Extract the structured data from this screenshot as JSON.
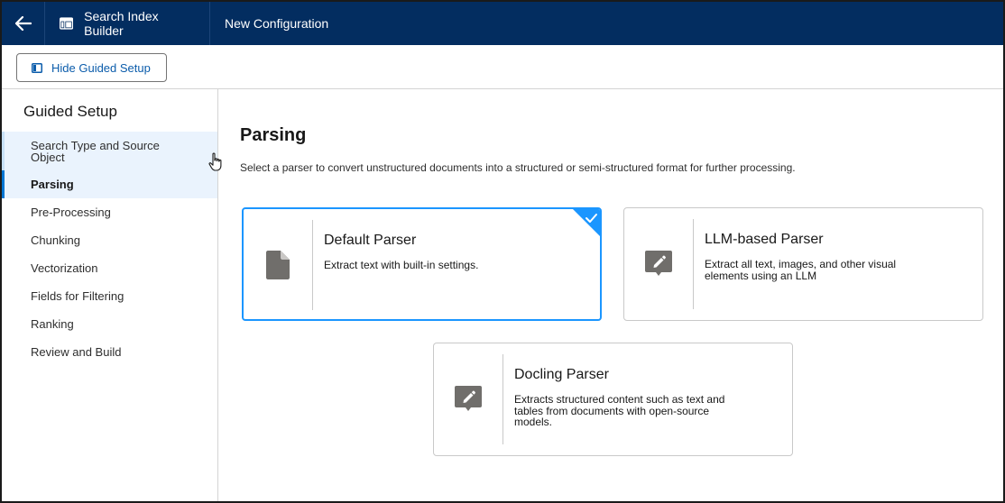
{
  "header": {
    "app_name": "Search Index Builder",
    "page_title": "New Configuration",
    "bg_color": "#032d60"
  },
  "toolbar": {
    "hide_button_label": "Hide Guided Setup"
  },
  "sidebar": {
    "title": "Guided Setup",
    "steps": [
      {
        "label": "Search Type and Source Object",
        "state": "hover"
      },
      {
        "label": "Parsing",
        "state": "active"
      },
      {
        "label": "Pre-Processing",
        "state": "default"
      },
      {
        "label": "Chunking",
        "state": "default"
      },
      {
        "label": "Vectorization",
        "state": "default"
      },
      {
        "label": "Fields for Filtering",
        "state": "default"
      },
      {
        "label": "Ranking",
        "state": "default"
      },
      {
        "label": "Review and Build",
        "state": "default"
      }
    ]
  },
  "main": {
    "title": "Parsing",
    "description": "Select a parser to convert unstructured documents into a structured or semi-structured format for further processing.",
    "options": [
      {
        "title": "Default Parser",
        "description": "Extract text with built-in settings.",
        "icon": "file-icon",
        "selected": true
      },
      {
        "title": "LLM-based Parser",
        "description": "Extract all text, images, and other visual elements using an LLM",
        "icon": "edit-icon",
        "selected": false
      },
      {
        "title": "Docling Parser",
        "description": "Extracts structured content such as text and tables from documents with open-source models.",
        "icon": "edit-icon",
        "selected": false
      }
    ]
  },
  "colors": {
    "accent": "#1b96ff",
    "brand_blue": "#0176d3",
    "link_blue": "#0b5cab",
    "icon_gray": "#706e6b"
  }
}
